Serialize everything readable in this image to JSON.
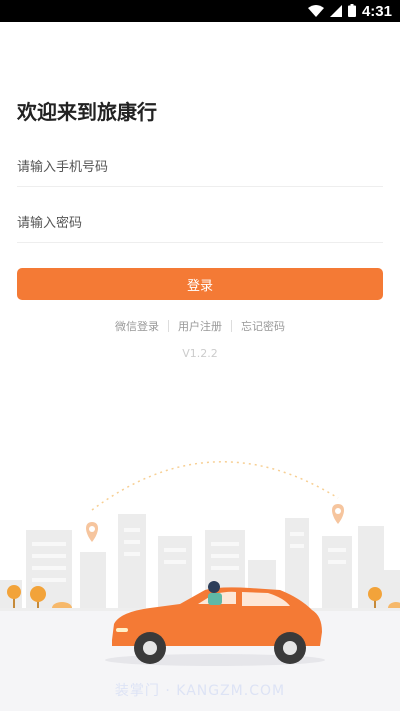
{
  "status_bar": {
    "time": "4:31",
    "icons": [
      "wifi-icon",
      "signal-icon",
      "battery-icon"
    ]
  },
  "login": {
    "title": "欢迎来到旅康行",
    "phone_placeholder": "请输入手机号码",
    "password_placeholder": "请输入密码",
    "login_button": "登录",
    "links": [
      "微信登录",
      "用户注册",
      "忘记密码"
    ],
    "version": "V1.2.2"
  },
  "watermark": "装掌门 · KANGZM.COM",
  "colors": {
    "accent": "#f47a35",
    "car": "#f47a35",
    "tree": "#f2a33a",
    "building": "#eeeeee",
    "pin": "#f6c59e"
  }
}
